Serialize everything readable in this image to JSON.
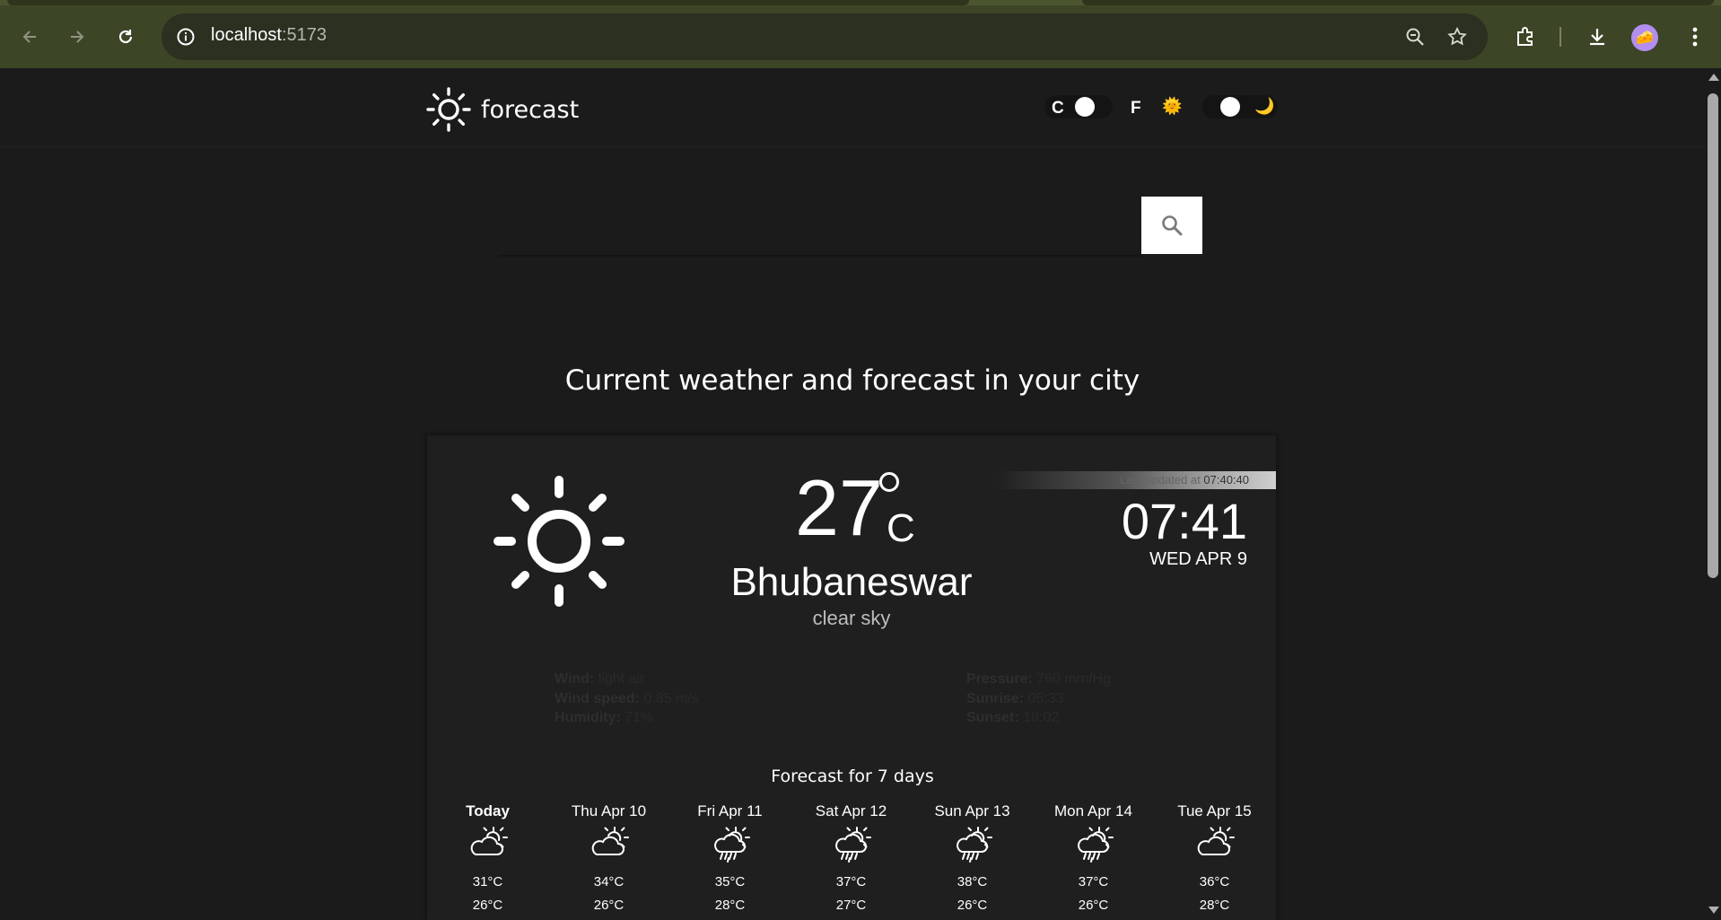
{
  "browser": {
    "url_host": "localhost",
    "url_port": ":5173"
  },
  "header": {
    "logo_text": "forecast",
    "unit_c_label": "C",
    "unit_f_label": "F",
    "sun_emoji": "🌞",
    "moon_emoji": "🌙"
  },
  "search": {
    "placeholder": "",
    "value": ""
  },
  "subtitle": "Current weather and forecast in your city",
  "current": {
    "temperature": "27",
    "unit": "C",
    "city": "Bhubaneswar",
    "description": "clear sky",
    "updated_label": "Last updated at",
    "updated_time": "07:40:40",
    "clock": "07:41",
    "date": "WED APR 9"
  },
  "details_left": [
    {
      "label": "Wind:",
      "value": "light air"
    },
    {
      "label": "Wind speed:",
      "value": "0.85 m/s"
    },
    {
      "label": "Humidity:",
      "value": "71%"
    }
  ],
  "details_right": [
    {
      "label": "Pressure:",
      "value": "760 mm/Hg"
    },
    {
      "label": "Sunrise:",
      "value": "05:33"
    },
    {
      "label": "Sunset:",
      "value": "18:02"
    }
  ],
  "forecast": {
    "title": "Forecast for 7 days",
    "days": [
      {
        "name": "Today",
        "icon": "partly-cloudy-icon",
        "max": "31°C",
        "min": "26°C"
      },
      {
        "name": "Thu Apr 10",
        "icon": "partly-cloudy-icon",
        "max": "34°C",
        "min": "26°C"
      },
      {
        "name": "Fri Apr 11",
        "icon": "rain-sun-icon",
        "max": "35°C",
        "min": "28°C"
      },
      {
        "name": "Sat Apr 12",
        "icon": "rain-sun-icon",
        "max": "37°C",
        "min": "27°C"
      },
      {
        "name": "Sun Apr 13",
        "icon": "rain-sun-icon",
        "max": "38°C",
        "min": "26°C"
      },
      {
        "name": "Mon Apr 14",
        "icon": "rain-sun-icon",
        "max": "37°C",
        "min": "26°C"
      },
      {
        "name": "Tue Apr 15",
        "icon": "partly-cloudy-icon",
        "max": "36°C",
        "min": "28°C"
      }
    ]
  },
  "colors": {
    "background": "#1b1b1b",
    "card": "#1f1f1f",
    "chrome": "#3d4527",
    "text": "#ffffff"
  }
}
